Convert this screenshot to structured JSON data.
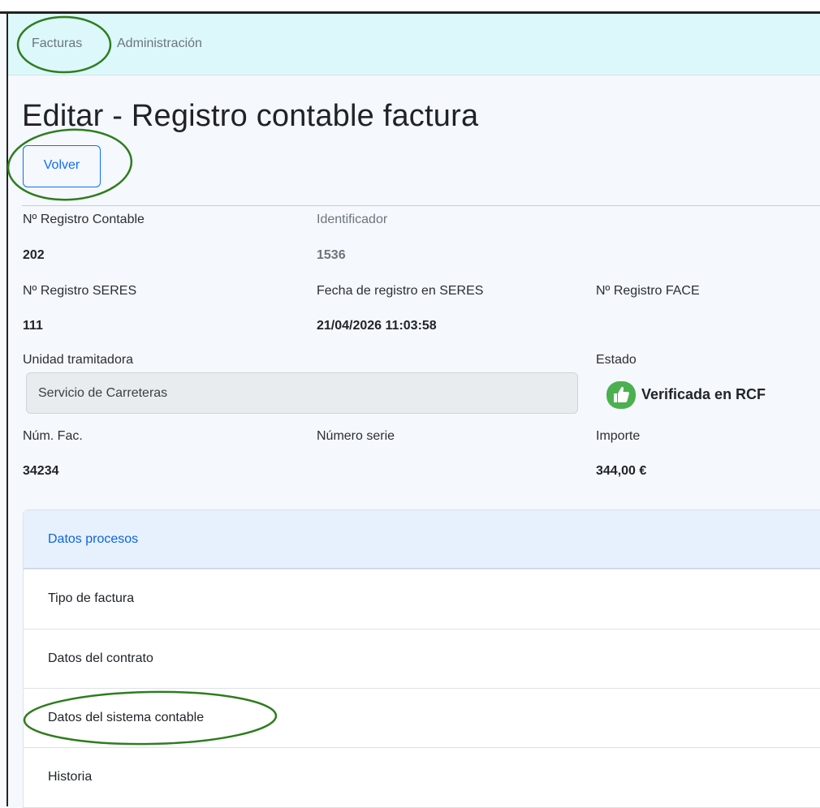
{
  "nav": {
    "items": [
      {
        "label": "Facturas"
      },
      {
        "label": "Administración"
      }
    ]
  },
  "page": {
    "title": "Editar - Registro contable factura",
    "back_label": "Volver"
  },
  "fields": {
    "registro_contable": {
      "label": "Nº Registro Contable",
      "value": "202"
    },
    "identificador": {
      "label": "Identificador",
      "value": "1536"
    },
    "registro_seres": {
      "label": "Nº Registro SERES",
      "value": "111"
    },
    "fecha_seres": {
      "label": "Fecha de registro en SERES",
      "value": "21/04/2026 11:03:58"
    },
    "registro_face": {
      "label": "Nº Registro FACE",
      "value": ""
    },
    "unidad_tramitadora": {
      "label": "Unidad tramitadora",
      "value": "Servicio de Carreteras"
    },
    "estado": {
      "label": "Estado",
      "value": "Verificada en RCF",
      "icon": "thumbs-up-icon",
      "color": "#4caf50"
    },
    "num_fac": {
      "label": "Núm. Fac.",
      "value": "34234"
    },
    "numero_serie": {
      "label": "Número serie",
      "value": ""
    },
    "importe": {
      "label": "Importe",
      "value": "344,00 €"
    }
  },
  "accordion": {
    "header": "Datos procesos",
    "items": [
      {
        "label": "Tipo de factura"
      },
      {
        "label": "Datos del contrato"
      },
      {
        "label": "Datos del sistema contable"
      },
      {
        "label": "Historia"
      }
    ]
  },
  "colors": {
    "navbar_bg": "#dcf8fa",
    "primary": "#0d6efd",
    "annotation": "#2e7d1e",
    "status_green": "#4caf50"
  }
}
